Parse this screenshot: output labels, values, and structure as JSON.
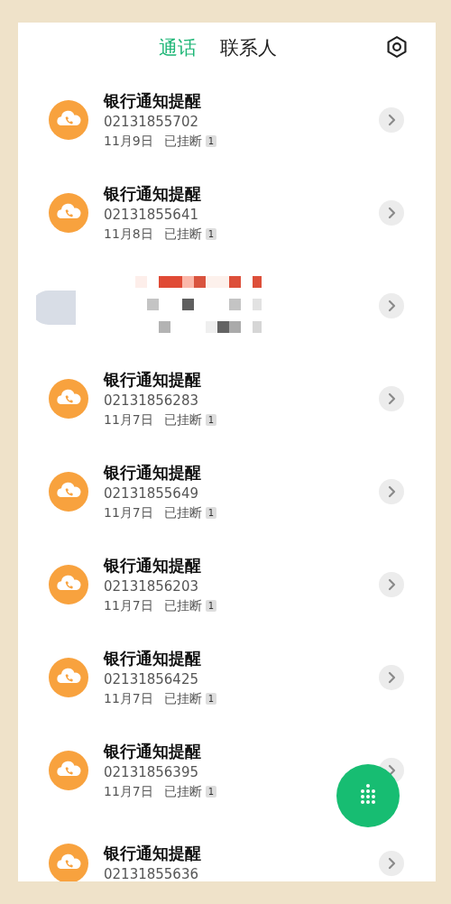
{
  "tabs": [
    {
      "label": "通话",
      "selected": true
    },
    {
      "label": "联系人",
      "selected": false
    }
  ],
  "calls": [
    {
      "kind": "call",
      "name": "银行通知提醒",
      "number": "02131855702",
      "date": "11月9日",
      "status": "已挂断",
      "count": "1"
    },
    {
      "kind": "call",
      "name": "银行通知提醒",
      "number": "02131855641",
      "date": "11月8日",
      "status": "已挂断",
      "count": "1"
    },
    {
      "kind": "redacted"
    },
    {
      "kind": "call",
      "name": "银行通知提醒",
      "number": "02131856283",
      "date": "11月7日",
      "status": "已挂断",
      "count": "1"
    },
    {
      "kind": "call",
      "name": "银行通知提醒",
      "number": "02131855649",
      "date": "11月7日",
      "status": "已挂断",
      "count": "1"
    },
    {
      "kind": "call",
      "name": "银行通知提醒",
      "number": "02131856203",
      "date": "11月7日",
      "status": "已挂断",
      "count": "1"
    },
    {
      "kind": "call",
      "name": "银行通知提醒",
      "number": "02131856425",
      "date": "11月7日",
      "status": "已挂断",
      "count": "1"
    },
    {
      "kind": "call",
      "name": "银行通知提醒",
      "number": "02131856395",
      "date": "11月7日",
      "status": "已挂断",
      "count": "1"
    },
    {
      "kind": "call",
      "name": "银行通知提醒",
      "number": "02131855636"
    }
  ]
}
